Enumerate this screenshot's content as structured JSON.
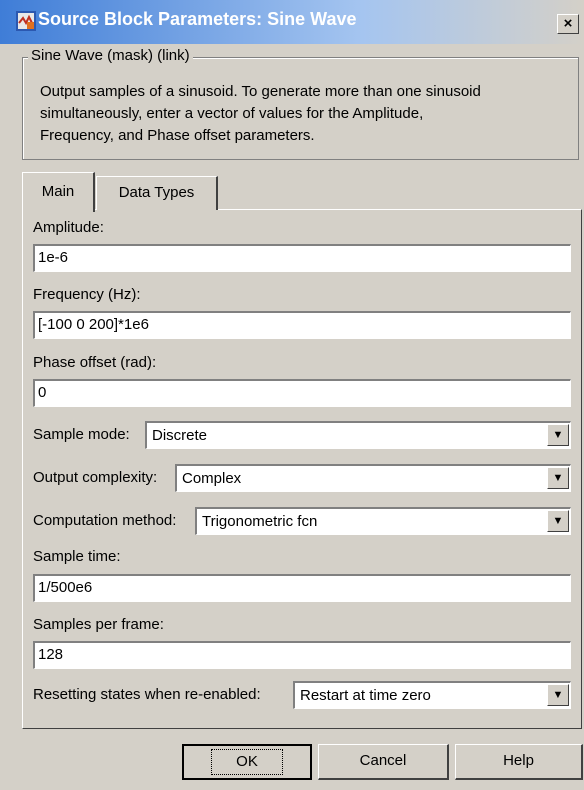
{
  "window": {
    "title": "Source Block Parameters: Sine Wave",
    "close_glyph": "×"
  },
  "mask": {
    "title": "Sine Wave (mask) (link)",
    "description_lines": [
      "Output samples of a sinusoid.  To generate more than one sinusoid",
      "simultaneously, enter a vector of values for the Amplitude,",
      "Frequency, and Phase offset parameters."
    ]
  },
  "tabs": [
    {
      "label": "Main"
    },
    {
      "label": "Data Types"
    }
  ],
  "fields": {
    "amplitude": {
      "label": "Amplitude:",
      "value": "1e-6"
    },
    "frequency": {
      "label": "Frequency (Hz):",
      "value": "[-100 0 200]*1e6"
    },
    "phase": {
      "label": "Phase offset (rad):",
      "value": "0"
    },
    "sample_time": {
      "label": "Sample time:",
      "value": "1/500e6"
    },
    "samples_per_frame": {
      "label": "Samples per frame:",
      "value": "128"
    }
  },
  "selects": {
    "sample_mode": {
      "label": "Sample mode:",
      "value": "Discrete"
    },
    "output_complexity": {
      "label": "Output complexity:",
      "value": "Complex"
    },
    "computation_method": {
      "label": "Computation method:",
      "value": "Trigonometric fcn"
    },
    "resetting": {
      "label": "Resetting states when re-enabled:",
      "value": "Restart at time zero"
    }
  },
  "buttons": {
    "ok": "OK",
    "cancel": "Cancel",
    "help": "Help"
  },
  "icons": {
    "app": "simulink-block-icon",
    "dropdown": "chevron-down-icon"
  },
  "colors": {
    "titlebar_start": "#3f7dd7",
    "titlebar_end": "#d4d0c8",
    "face": "#d4d0c8"
  }
}
